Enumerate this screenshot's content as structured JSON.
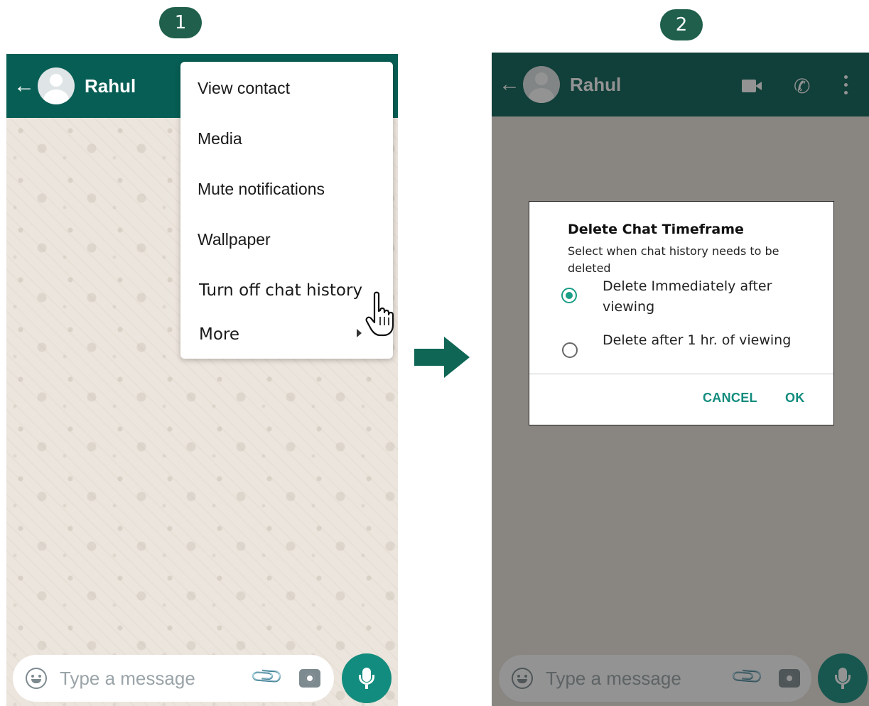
{
  "steps": {
    "step1": "1",
    "step2": "2"
  },
  "chat": {
    "contact_name": "Rahul",
    "input_placeholder": "Type a message"
  },
  "menu": {
    "items": [
      "View contact",
      "Media",
      "Mute notifications",
      "Wallpaper",
      "Turn off chat history",
      "More"
    ]
  },
  "dialog": {
    "title": "Delete Chat Timeframe",
    "subtitle": "Select when chat history needs to be deleted",
    "options": [
      {
        "label": "Delete Immediately after viewing",
        "selected": true
      },
      {
        "label": "Delete after 1 hr. of viewing",
        "selected": false
      }
    ],
    "cancel_label": "CANCEL",
    "ok_label": "OK"
  },
  "colors": {
    "header": "#075e54",
    "accent": "#128c7e",
    "badge": "#1f5f4c",
    "chat_background": "#ece5dd"
  },
  "icons": {
    "back": "arrow-left-icon",
    "video": "video-call-icon",
    "voice": "phone-icon",
    "menu": "more-vert-icon",
    "emoji": "emoji-icon",
    "attach": "paperclip-icon",
    "camera": "camera-icon",
    "mic": "mic-icon",
    "cursor": "hand-pointer-icon",
    "flow": "right-arrow-icon"
  }
}
